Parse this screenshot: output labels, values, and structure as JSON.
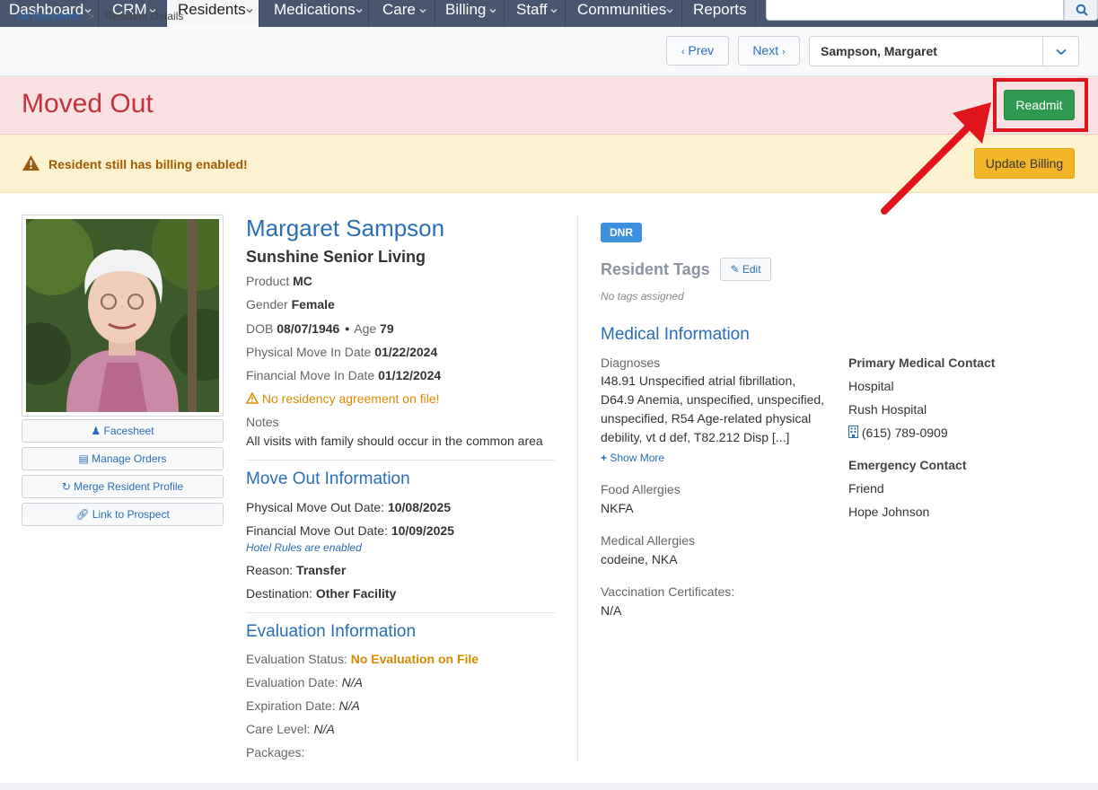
{
  "nav": {
    "items": [
      {
        "label": "Dashboard",
        "caret": true
      },
      {
        "label": "CRM",
        "caret": true
      },
      {
        "label": "Residents",
        "caret": true
      },
      {
        "label": "Medications",
        "caret": true
      },
      {
        "label": "Care",
        "caret": true
      },
      {
        "label": "Billing",
        "caret": true
      },
      {
        "label": "Staff",
        "caret": true
      },
      {
        "label": "Communities",
        "caret": true
      },
      {
        "label": "Reports",
        "caret": false
      }
    ],
    "active": "Residents",
    "search": {
      "placeholder": ""
    }
  },
  "breadcrumb": {
    "link": "All Residents",
    "separator": ">",
    "current": "Resident Details"
  },
  "pager": {
    "prev": "Prev",
    "next": "Next",
    "resident_selected": "Sampson, Margaret"
  },
  "status": {
    "title": "Moved Out",
    "readmit_label": "Readmit"
  },
  "billing_warning": {
    "text": "Resident still has billing enabled!",
    "button": "Update Billing"
  },
  "side_actions": {
    "facesheet": "Facesheet",
    "manage_orders": "Manage Orders",
    "merge": "Merge Resident Profile",
    "link_prospect": "Link to Prospect"
  },
  "resident": {
    "name": "Margaret Sampson",
    "community": "Sunshine Senior Living",
    "product_label": "Product",
    "product": "MC",
    "gender_label": "Gender",
    "gender": "Female",
    "dob_label": "DOB",
    "dob": "08/07/1946",
    "dot": "•",
    "age_label": "Age",
    "age": "79",
    "phys_move_in_label": "Physical Move In Date",
    "phys_move_in": "01/22/2024",
    "fin_move_in_label": "Financial Move In Date",
    "fin_move_in": "01/12/2024",
    "residency_warning": "No residency agreement on file!",
    "notes_label": "Notes",
    "notes": "All visits with family should occur in the common area"
  },
  "move_out": {
    "title": "Move Out Information",
    "phys_label": "Physical Move Out Date:",
    "phys": "10/08/2025",
    "fin_label": "Financial Move Out Date:",
    "fin": "10/09/2025",
    "hotel_rules": "Hotel Rules are enabled",
    "reason_label": "Reason:",
    "reason": "Transfer",
    "destination_label": "Destination:",
    "destination": "Other Facility"
  },
  "evaluation": {
    "title": "Evaluation Information",
    "status_label": "Evaluation Status:",
    "status": "No Evaluation on File",
    "date_label": "Evaluation Date:",
    "date": "N/A",
    "expiration_label": "Expiration Date:",
    "expiration": "N/A",
    "care_level_label": "Care Level:",
    "care_level": "N/A",
    "packages_label": "Packages:"
  },
  "right": {
    "badge": "DNR",
    "tags_title": "Resident Tags",
    "tags_edit": "Edit",
    "no_tags": "No tags assigned",
    "medical_title": "Medical Information",
    "diagnoses_label": "Diagnoses",
    "diagnoses_lines": [
      "I48.91 Unspecified atrial fibrillation,",
      "D64.9 Anemia, unspecified, unspecified,",
      "unspecified, R54 Age-related physical",
      "debility, vt d def, T82.212 Disp [...]"
    ],
    "show_more": "Show More",
    "food_allergies_label": "Food Allergies",
    "food_allergies": "NKFA",
    "medical_allergies_label": "Medical Allergies",
    "medical_allergies": "codeine, NKA",
    "vaccination_label": "Vaccination Certificates:",
    "vaccination": "N/A",
    "primary_contact_label": "Primary Medical Contact",
    "primary_contact_type": "Hospital",
    "primary_contact_name": "Rush Hospital",
    "primary_contact_phone": "(615) 789-0909",
    "emergency_label": "Emergency Contact",
    "emergency_relation": "Friend",
    "emergency_name": "Hope Johnson"
  },
  "colors": {
    "nav": "#485670",
    "link": "#2a6db5",
    "moved_out": "#c0333f",
    "readmit": "#2f9a4f",
    "warning": "#f2b525",
    "annotation": "#e0141b"
  }
}
